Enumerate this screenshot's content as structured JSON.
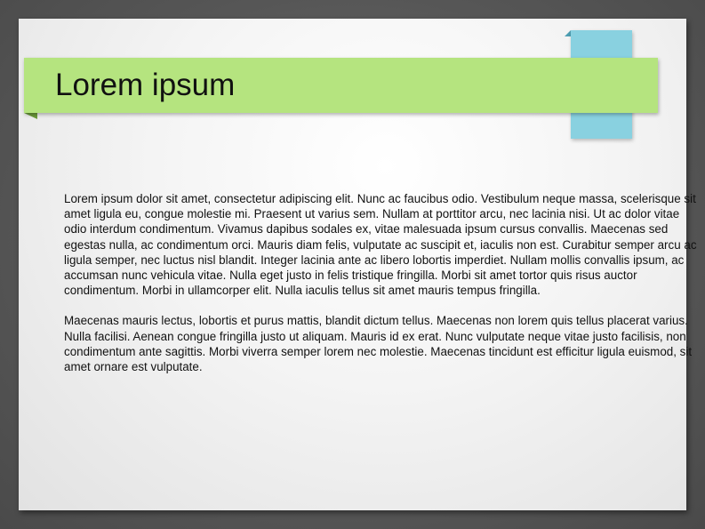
{
  "slide": {
    "title": "Lorem ipsum",
    "paragraphs": [
      "Lorem ipsum dolor sit amet, consectetur adipiscing elit. Nunc ac faucibus odio. Vestibulum neque massa, scelerisque sit amet ligula eu, congue molestie mi. Praesent ut varius sem. Nullam at porttitor arcu, nec lacinia nisi. Ut ac dolor vitae odio interdum condimentum. Vivamus dapibus sodales ex, vitae malesuada ipsum cursus convallis. Maecenas sed egestas nulla, ac condimentum orci. Mauris diam felis, vulputate ac suscipit et, iaculis non est. Curabitur semper arcu ac ligula semper, nec luctus nisl blandit. Integer lacinia ante ac libero lobortis imperdiet. Nullam mollis convallis ipsum, ac accumsan nunc vehicula vitae. Nulla eget justo in felis tristique fringilla. Morbi sit amet tortor quis risus auctor condimentum. Morbi in ullamcorper elit. Nulla iaculis tellus sit amet mauris tempus fringilla.",
      "Maecenas mauris lectus, lobortis et purus mattis, blandit dictum tellus. Maecenas non lorem quis tellus placerat varius. Nulla facilisi. Aenean congue fringilla justo ut aliquam. Mauris id ex erat. Nunc vulputate neque vitae justo facilisis, non condimentum ante sagittis. Morbi viverra semper lorem nec molestie. Maecenas tincidunt est efficitur ligula euismod, sit amet ornare est vulputate."
    ]
  },
  "colors": {
    "title_bar": "#b5e47f",
    "accent_tab": "#89d1e0",
    "background": "#565656",
    "slide": "#f4f4f4"
  }
}
